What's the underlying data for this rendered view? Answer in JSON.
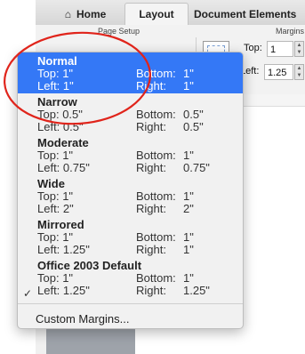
{
  "ribbon": {
    "tabs": [
      {
        "label": "Home"
      },
      {
        "label": "Layout"
      },
      {
        "label": "Document Elements"
      }
    ],
    "groups": {
      "page_setup": "Page Setup",
      "margins": "Margins"
    },
    "fields": {
      "top_label": "Top:",
      "top_value": "1",
      "left_label": "Left:",
      "left_value": "1.25"
    }
  },
  "menu": {
    "presets": [
      {
        "name": "Normal",
        "top_label": "Top:",
        "top": "1\"",
        "bottom_label": "Bottom:",
        "bottom": "1\"",
        "left_label": "Left:",
        "left": "1\"",
        "right_label": "Right:",
        "right": "1\"",
        "selected": true,
        "checked": false
      },
      {
        "name": "Narrow",
        "top_label": "Top:",
        "top": "0.5\"",
        "bottom_label": "Bottom:",
        "bottom": "0.5\"",
        "left_label": "Left:",
        "left": "0.5\"",
        "right_label": "Right:",
        "right": "0.5\"",
        "selected": false,
        "checked": false
      },
      {
        "name": "Moderate",
        "top_label": "Top:",
        "top": "1\"",
        "bottom_label": "Bottom:",
        "bottom": "1\"",
        "left_label": "Left:",
        "left": "0.75\"",
        "right_label": "Right:",
        "right": "0.75\"",
        "selected": false,
        "checked": false
      },
      {
        "name": "Wide",
        "top_label": "Top:",
        "top": "1\"",
        "bottom_label": "Bottom:",
        "bottom": "1\"",
        "left_label": "Left:",
        "left": "2\"",
        "right_label": "Right:",
        "right": "2\"",
        "selected": false,
        "checked": false
      },
      {
        "name": "Mirrored",
        "top_label": "Top:",
        "top": "1\"",
        "bottom_label": "Bottom:",
        "bottom": "1\"",
        "left_label": "Left:",
        "left": "1.25\"",
        "right_label": "Right:",
        "right": "1\"",
        "selected": false,
        "checked": false
      },
      {
        "name": "Office 2003 Default",
        "top_label": "Top:",
        "top": "1\"",
        "bottom_label": "Bottom:",
        "bottom": "1\"",
        "left_label": "Left:",
        "left": "1.25\"",
        "right_label": "Right:",
        "right": "1.25\"",
        "selected": false,
        "checked": true
      }
    ],
    "check_glyph": "✓",
    "custom_label": "Custom Margins..."
  },
  "colors": {
    "selection": "#3478f6",
    "annotation": "#e0241b"
  },
  "icons": {
    "home": "house-icon",
    "check": "checkmark-icon"
  }
}
